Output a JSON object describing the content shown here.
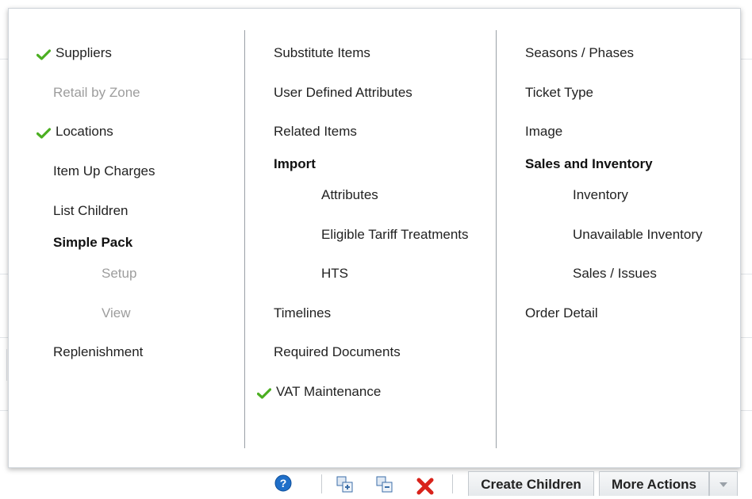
{
  "menu": {
    "col1": {
      "suppliers": "Suppliers",
      "retail_by_zone": "Retail by Zone",
      "locations": "Locations",
      "item_up_charges": "Item Up Charges",
      "list_children": "List Children",
      "simple_pack": "Simple Pack",
      "setup": "Setup",
      "view": "View",
      "replenishment": "Replenishment"
    },
    "col2": {
      "substitute_items": "Substitute Items",
      "user_defined_attributes": "User Defined Attributes",
      "related_items": "Related Items",
      "import": "Import",
      "attributes": "Attributes",
      "eligible_tariff_treatments": "Eligible Tariff Treatments",
      "hts": "HTS",
      "timelines": "Timelines",
      "required_documents": "Required Documents",
      "vat_maintenance": "VAT Maintenance"
    },
    "col3": {
      "seasons_phases": "Seasons / Phases",
      "ticket_type": "Ticket Type",
      "image": "Image",
      "sales_and_inventory": "Sales and Inventory",
      "inventory": "Inventory",
      "unavailable_inventory": "Unavailable Inventory",
      "sales_issues": "Sales / Issues",
      "order_detail": "Order Detail"
    }
  },
  "toolbar": {
    "create_children": "Create Children",
    "more_actions": "More Actions"
  },
  "colors": {
    "check": "#4caf22",
    "disabled_text": "#9d9d9d",
    "help_blue": "#1f6fc9",
    "delete_red": "#d9231b"
  },
  "icons": [
    "check-icon",
    "help-icon",
    "expand-all-icon",
    "collapse-all-icon",
    "delete-icon",
    "dropdown-arrow-icon"
  ]
}
